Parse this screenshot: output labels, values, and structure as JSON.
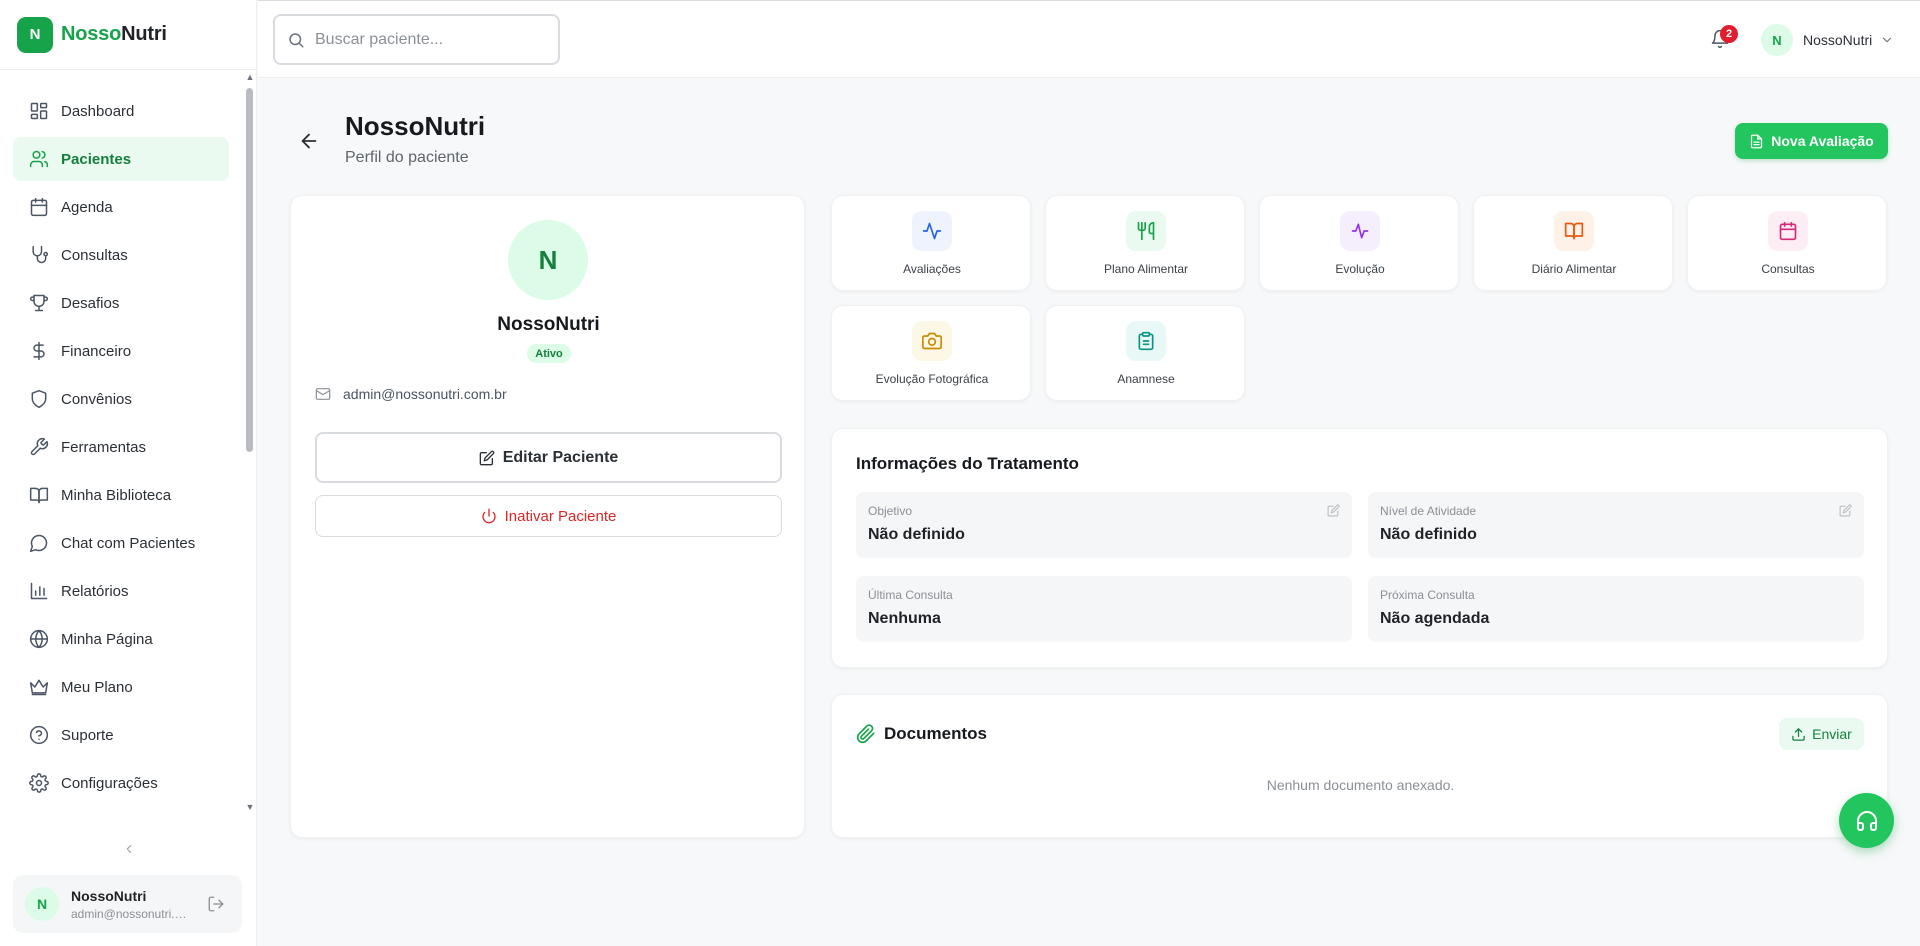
{
  "brand": {
    "logo_letter": "N",
    "name_part1": "Nosso",
    "name_part2": "Nutri"
  },
  "sidebar": {
    "items": [
      {
        "label": "Dashboard",
        "icon": "layout-dashboard-icon"
      },
      {
        "label": "Pacientes",
        "icon": "users-icon",
        "active": true
      },
      {
        "label": "Agenda",
        "icon": "calendar-icon"
      },
      {
        "label": "Consultas",
        "icon": "stethoscope-icon"
      },
      {
        "label": "Desafios",
        "icon": "trophy-icon"
      },
      {
        "label": "Financeiro",
        "icon": "dollar-icon"
      },
      {
        "label": "Convênios",
        "icon": "shield-icon"
      },
      {
        "label": "Ferramentas",
        "icon": "wrench-icon"
      },
      {
        "label": "Minha Biblioteca",
        "icon": "book-icon"
      },
      {
        "label": "Chat com Pacientes",
        "icon": "message-circle-icon"
      },
      {
        "label": "Relatórios",
        "icon": "bar-chart-icon"
      },
      {
        "label": "Minha Página",
        "icon": "globe-icon"
      },
      {
        "label": "Meu Plano",
        "icon": "crown-icon"
      },
      {
        "label": "Suporte",
        "icon": "help-circle-icon"
      },
      {
        "label": "Configurações",
        "icon": "settings-icon"
      }
    ],
    "user": {
      "initial": "N",
      "name": "NossoNutri",
      "email": "admin@nossonutri.com.br"
    }
  },
  "topbar": {
    "search_placeholder": "Buscar paciente...",
    "notifications_count": "2",
    "user_initial": "N",
    "user_name": "NossoNutri"
  },
  "header": {
    "title": "NossoNutri",
    "subtitle": "Perfil do paciente",
    "new_eval_label": "Nova Avaliação"
  },
  "profile": {
    "initial": "N",
    "name": "NossoNutri",
    "status": "Ativo",
    "email": "admin@nossonutri.com.br",
    "edit_label": "Editar Paciente",
    "inactivate_label": "Inativar Paciente"
  },
  "tiles": [
    {
      "label": "Avaliações",
      "icon": "activity-icon",
      "color": "#2563eb",
      "bg": "#eef3fe"
    },
    {
      "label": "Plano Alimentar",
      "icon": "utensils-icon",
      "color": "#16a34a",
      "bg": "#eafaf0"
    },
    {
      "label": "Evolução",
      "icon": "pulse-icon",
      "color": "#9333ea",
      "bg": "#f5eefd"
    },
    {
      "label": "Diário Alimentar",
      "icon": "book-open-icon",
      "color": "#ea580c",
      "bg": "#fdf1e8"
    },
    {
      "label": "Consultas",
      "icon": "calendar-icon",
      "color": "#db2777",
      "bg": "#fdeef5"
    },
    {
      "label": "Evolução Fotográfica",
      "icon": "camera-icon",
      "color": "#ca8a04",
      "bg": "#fdf8e6"
    },
    {
      "label": "Anamnese",
      "icon": "clipboard-icon",
      "color": "#0d9488",
      "bg": "#e8f8f6"
    }
  ],
  "treatment": {
    "title": "Informações do Tratamento",
    "fields": [
      {
        "label": "Objetivo",
        "value": "Não definido",
        "editable": true
      },
      {
        "label": "Nível de Atividade",
        "value": "Não definido",
        "editable": true
      },
      {
        "label": "Última Consulta",
        "value": "Nenhuma",
        "editable": false
      },
      {
        "label": "Próxima Consulta",
        "value": "Não agendada",
        "editable": false
      }
    ]
  },
  "documents": {
    "title": "Documentos",
    "send_label": "Enviar",
    "empty_text": "Nenhum documento anexado."
  },
  "colors": {
    "accent": "#16a34a",
    "accent_light": "#dcfce7",
    "danger": "#dc2626"
  }
}
